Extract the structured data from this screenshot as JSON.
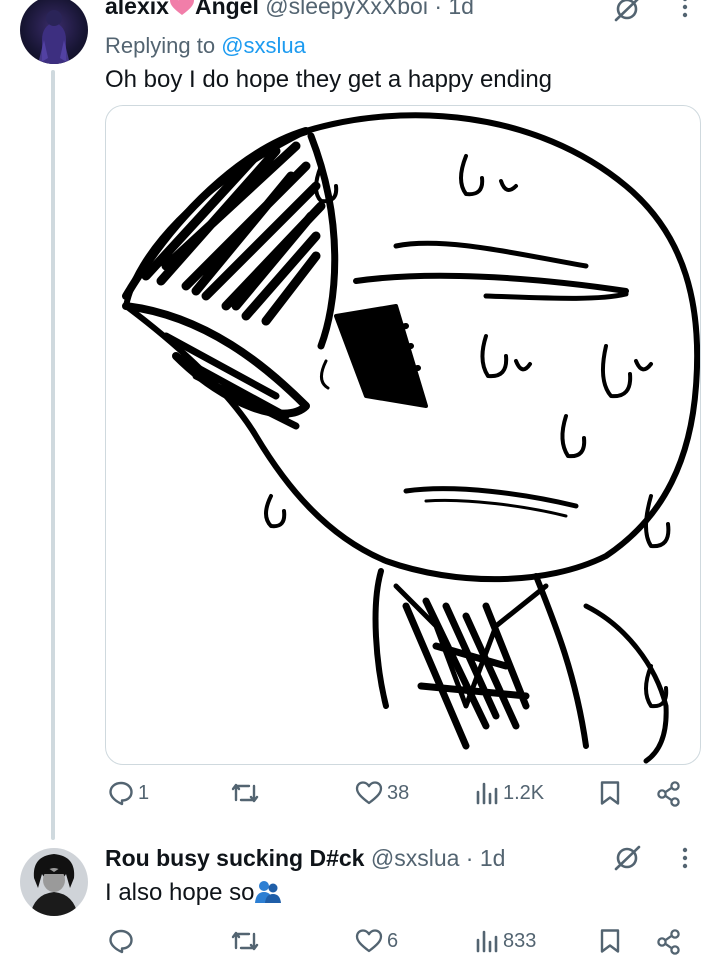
{
  "tweet1": {
    "display_name": "alexix",
    "display_name_2": "Angel",
    "handle": "@sleepyXxXboi",
    "time": "· 1d",
    "replying_prefix": "Replying to",
    "replying_to": "@sxslua",
    "text": "Oh boy I do hope they get a happy ending",
    "media_icon_name": "drawing-sweating-face",
    "actions": {
      "replies": "1",
      "reposts": "",
      "likes": "38",
      "views": "1.2K"
    }
  },
  "tweet2": {
    "display_name": "Rou busy sucking D#ck",
    "handle": "@sxslua",
    "time": "· 1d",
    "text": "I also hope so",
    "emoji": "people-hugging",
    "actions": {
      "replies": "",
      "reposts": "",
      "likes": "6",
      "views": "833"
    }
  },
  "colors": {
    "text": "#0f1419",
    "secondary": "#536471",
    "link": "#1d9bf0",
    "heart_emoji": "#f17ea9",
    "thread_line": "#cfd9de"
  }
}
